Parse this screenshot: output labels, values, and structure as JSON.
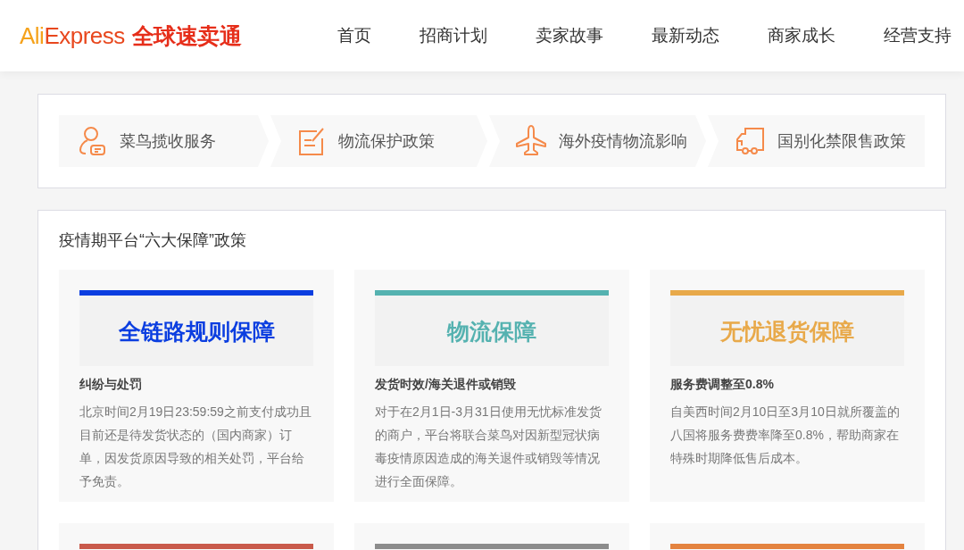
{
  "logo": {
    "part_1": "Ali",
    "part_2": "Express",
    "part_3": "全球速卖通"
  },
  "nav": [
    {
      "label": "首页"
    },
    {
      "label": "招商计划"
    },
    {
      "label": "卖家故事"
    },
    {
      "label": "最新动态"
    },
    {
      "label": "商家成长"
    },
    {
      "label": "经营支持"
    }
  ],
  "services": [
    {
      "label": "菜鸟揽收服务",
      "kind": "courier"
    },
    {
      "label": "物流保护政策",
      "kind": "document"
    },
    {
      "label": "海外疫情物流影响",
      "kind": "plane"
    },
    {
      "label": "国别化禁限售政策",
      "kind": "truck"
    }
  ],
  "section": {
    "title": "疫情期平台“六大保障”政策",
    "cards": [
      {
        "color": "#0b3ee0",
        "banner": "全链路规则保障",
        "subtitle": "纠纷与处罚",
        "text": "北京时间2月19日23:59:59之前支付成功且目前还是待发货状态的（国内商家）订单，因发货原因导致的相关处罚，平台给予免责。"
      },
      {
        "color": "#55b2b0",
        "banner": "物流保障",
        "subtitle": "发货时效/海关退件或销毁",
        "text": "对于在2月1日-3月31日使用无忧标准发货的商户，平台将联合菜鸟对因新型冠状病毒疫情原因造成的海关退件或销毁等情况进行全面保障。"
      },
      {
        "color": "#e8a94a",
        "banner": "无忧退货保障",
        "subtitle": "服务费调整至0.8%",
        "text": "自美西时间2月10日至3月10日就所覆盖的八国将服务费费率降至0.8%，帮助商家在特殊时期降低售后成本。"
      },
      {
        "color": "#c95a4b"
      },
      {
        "color": "#8c8c8c"
      },
      {
        "color": "#e4833f"
      }
    ]
  }
}
